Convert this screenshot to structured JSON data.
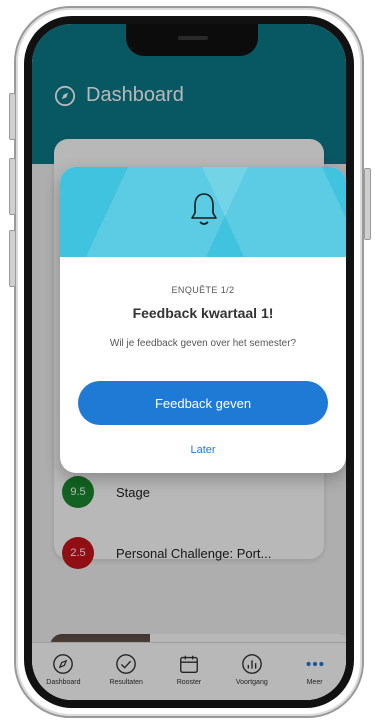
{
  "header": {
    "title": "Dashboard"
  },
  "modal": {
    "counter": "ENQUÊTE 1/2",
    "title": "Feedback kwartaal 1!",
    "subtitle": "Wil je feedback geven over het semester?",
    "primary_button": "Feedback geven",
    "secondary_link": "Later"
  },
  "results": [
    {
      "grade": "9.5",
      "title": "Stage",
      "color": "#1a8a2e"
    },
    {
      "grade": "2.5",
      "title": "Personal Challenge: Port...",
      "color": "#c8141d"
    }
  ],
  "tabs": [
    {
      "label": "Dashboard",
      "icon": "compass-icon"
    },
    {
      "label": "Resultaten",
      "icon": "check-circle-icon"
    },
    {
      "label": "Rooster",
      "icon": "calendar-icon"
    },
    {
      "label": "Voortgang",
      "icon": "progress-chart-icon"
    },
    {
      "label": "Meer",
      "icon": "more-dots-icon",
      "active": true
    }
  ],
  "colors": {
    "header": "#0b7a8a",
    "accent": "#1f7ad6",
    "modal_banner": "#3fc3df"
  }
}
